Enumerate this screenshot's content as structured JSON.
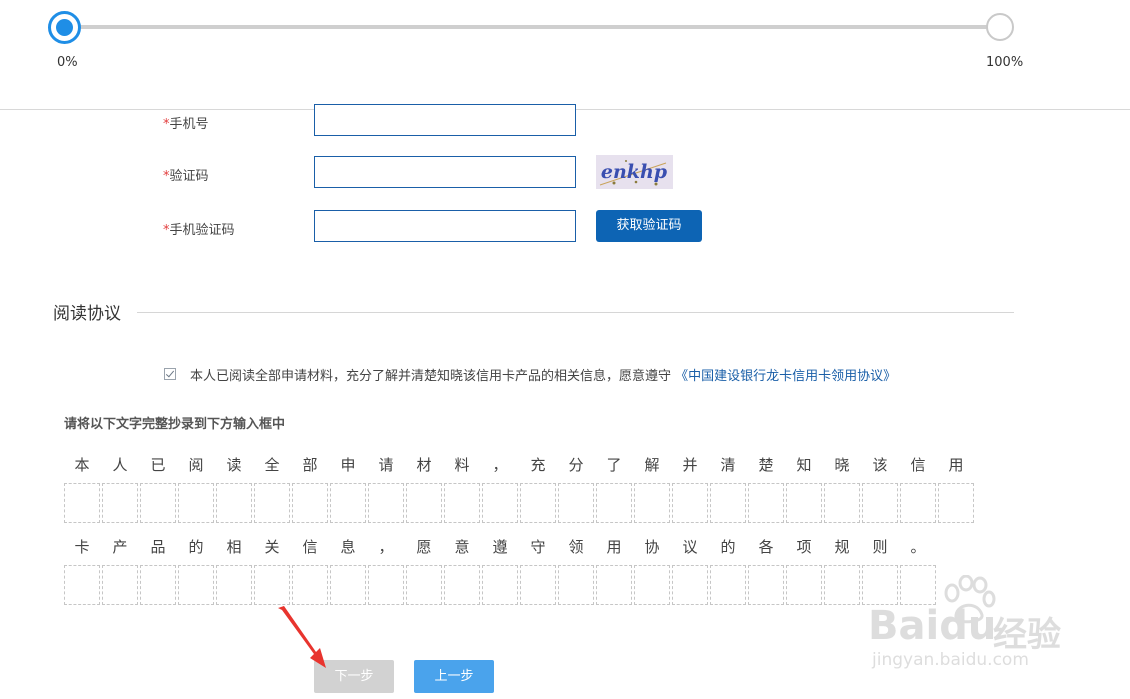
{
  "progress": {
    "value_percent": 0,
    "start_label": "0%",
    "end_label": "100%",
    "accent_color": "#1f8ee6"
  },
  "form": {
    "required_mark": "*",
    "fields": [
      {
        "label": "手机号",
        "value": ""
      },
      {
        "label": "验证码",
        "value": ""
      },
      {
        "label": "手机验证码",
        "value": ""
      }
    ],
    "captcha_text": "enkhp",
    "get_code_button": "获取验证码"
  },
  "agreement": {
    "section_title": "阅读协议",
    "checked": true,
    "text": "本人已阅读全部申请材料，充分了解并清楚知晓该信用卡产品的相关信息，愿意遵守",
    "link": "《中国建设银行龙卡信用卡领用协议》"
  },
  "copy_task": {
    "title": "请将以下文字完整抄录到下方输入框中",
    "line1": [
      "本",
      "人",
      "已",
      "阅",
      "读",
      "全",
      "部",
      "申",
      "请",
      "材",
      "料",
      "，",
      "充",
      "分",
      "了",
      "解",
      "并",
      "清",
      "楚",
      "知",
      "晓",
      "该",
      "信",
      "用"
    ],
    "line2": [
      "卡",
      "产",
      "品",
      "的",
      "相",
      "关",
      "信",
      "息",
      "，",
      "愿",
      "意",
      "遵",
      "守",
      "领",
      "用",
      "协",
      "议",
      "的",
      "各",
      "项",
      "规",
      "则",
      "。"
    ]
  },
  "buttons": {
    "next": "下一步",
    "prev": "上一步",
    "next_color": "#d2d2d2",
    "prev_color": "#4aa3ec"
  },
  "watermark": {
    "logo": "Baidu",
    "tag": "经验",
    "url": "jingyan.baidu.com"
  },
  "annotation_color": "#e8342e"
}
